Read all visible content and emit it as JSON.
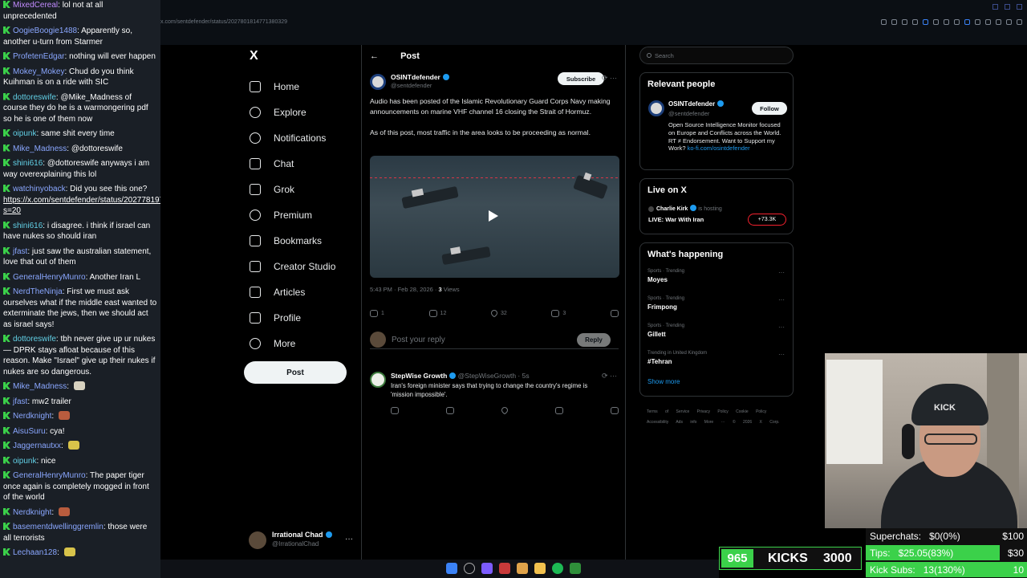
{
  "browser": {
    "url": "x.com/sentdefender/status/2027801814771380329"
  },
  "chat": {
    "messages": [
      {
        "user": "MixedCereal",
        "text": "lol not at all unprecedented",
        "color": "u-purple"
      },
      {
        "user": "OogieBoogie1488",
        "text": "Apparently so, another u-turn from Starmer",
        "color": "uname"
      },
      {
        "user": "ProfetenEdgar",
        "text": "nothing will ever happen",
        "color": "uname"
      },
      {
        "user": "Mokey_Mokey",
        "text": "Chud do you think Kuihman is on a ride with SIC",
        "color": "uname"
      },
      {
        "user": "dottoreswife",
        "text": "@Mike_Madness of course they do he is a warmongering pdf so he is one of them now",
        "color": "u-cyan"
      },
      {
        "user": "oipunk",
        "text": "same shit every time",
        "color": "u-cyan"
      },
      {
        "user": "Mike_Madness",
        "text": "@dottoreswife",
        "color": "uname"
      },
      {
        "user": "shini616",
        "text": "@dottoreswife anyways i am way overexplaining this lol",
        "color": "u-cyan"
      },
      {
        "user": "watchinyoback",
        "text": "Did you see this one?",
        "link": "https://x.com/sentdefender/status/2027781971875610711?s=20",
        "color": "uname"
      },
      {
        "user": "shini616",
        "text": "i disagree. i think if israel can have nukes so should iran",
        "color": "u-cyan"
      },
      {
        "user": "jfast",
        "text": "just saw the australian statement, love that out of them",
        "color": "uname"
      },
      {
        "user": "GeneralHenryMunro",
        "text": "Another Iran L",
        "color": "uname"
      },
      {
        "user": "NerdTheNinja",
        "text": "First we must ask ourselves what if the middle east wanted to exterminate the jews, then we should act as israel says!",
        "color": "uname"
      },
      {
        "user": "dottoreswife",
        "text": "tbh never give up ur nukes — DPRK stays afloat because of this reason. Make \"Israel\" give up their nukes if nukes are so dangerous.",
        "color": "u-cyan"
      },
      {
        "user": "Mike_Madness",
        "text": "",
        "color": "uname"
      },
      {
        "user": "jfast",
        "text": "mw2 trailer",
        "color": "uname"
      },
      {
        "user": "Nerdknight",
        "text": "",
        "color": "uname"
      },
      {
        "user": "AisuSuru",
        "text": "cya!",
        "color": "uname"
      },
      {
        "user": "Jaggernautxx",
        "text": "",
        "color": "uname"
      },
      {
        "user": "oipunk",
        "text": "nice",
        "color": "u-cyan"
      },
      {
        "user": "GeneralHenryMunro",
        "text": "The paper tiger once again is completely mogged in front of the world",
        "color": "uname"
      },
      {
        "user": "Nerdknight",
        "text": "",
        "color": "uname"
      },
      {
        "user": "basementdwellinggremlin",
        "text": "those were all terrorists",
        "color": "uname"
      },
      {
        "user": "Lechaan128",
        "text": "",
        "color": "uname"
      }
    ]
  },
  "sidebar": {
    "logo": "X",
    "items": [
      {
        "label": "Home",
        "icon": "home-icon"
      },
      {
        "label": "Explore",
        "icon": "search-icon"
      },
      {
        "label": "Notifications",
        "icon": "bell-icon"
      },
      {
        "label": "Chat",
        "icon": "mail-icon"
      },
      {
        "label": "Grok",
        "icon": "grok-icon"
      },
      {
        "label": "Premium",
        "icon": "premium-icon"
      },
      {
        "label": "Bookmarks",
        "icon": "bookmark-icon"
      },
      {
        "label": "Creator Studio",
        "icon": "creator-icon"
      },
      {
        "label": "Articles",
        "icon": "articles-icon"
      },
      {
        "label": "Profile",
        "icon": "profile-icon"
      },
      {
        "label": "More",
        "icon": "more-icon"
      }
    ],
    "post_label": "Post",
    "account": {
      "name": "Irrational Chad",
      "handle": "@IrrationalChad",
      "more": "···"
    }
  },
  "main": {
    "back": "←",
    "title": "Post",
    "post": {
      "name": "OSINTdefender",
      "handle": "@sentdefender",
      "subscribe": "Subscribe",
      "paragraph1": "Audio has been posted of the Islamic Revolutionary Guard Corps Navy making announcements on marine VHF channel 16 closing the Strait of Hormuz.",
      "paragraph2": "As of this post, most traffic in the area looks to be proceeding as normal.",
      "time": "5:43 PM · Feb 28, 2026 · ",
      "views_count": "3",
      "views_label": " Views",
      "replies": "1",
      "reposts": "12",
      "likes": "32",
      "bookmarks": "3"
    },
    "reply_placeholder": "Post your reply",
    "reply_button": "Reply",
    "reply": {
      "name": "StepWise Growth",
      "handle": "@StepWiseGrowth · 5s",
      "text": "Iran's foreign minister says that trying to change the country's regime is 'mission impossible'."
    }
  },
  "right": {
    "search_placeholder": "Search",
    "relevant_title": "Relevant people",
    "person": {
      "name": "OSINTdefender",
      "handle": "@sentdefender",
      "follow": "Follow",
      "bio": "Open Source Intelligence Monitor focused on Europe and Conflicts across the World. RT ≠ Endorsement. Want to Support my Work? ",
      "bio_link": "ko-fi.com/osintdefender"
    },
    "live_title": "Live on X",
    "live": {
      "host": "Charlie Kirk",
      "status": "is hosting",
      "title": "LIVE: War With Iran",
      "count": "+73.3K"
    },
    "happening_title": "What's happening",
    "trends": [
      {
        "category": "Sports · Trending",
        "topic": "Moyes"
      },
      {
        "category": "Sports · Trending",
        "topic": "Frimpong"
      },
      {
        "category": "Sports · Trending",
        "topic": "Gillett"
      },
      {
        "category": "Trending in United Kingdom",
        "topic": "#Tehran"
      }
    ],
    "show_more": "Show more",
    "footer": "Terms of Service  Privacy Policy  Cookie Policy  Accessibility  Ads info  More ···  © 2026 X Corp."
  },
  "overlay": {
    "kicks_count": "965",
    "kicks_label": "KICKS",
    "kicks_goal": "3000",
    "goals": [
      {
        "label": "Superchats:",
        "value": "$0(0%)",
        "target": "$100",
        "fraction": 0.0
      },
      {
        "label": "Tips:",
        "value": "$25.05(83%)",
        "target": "$30",
        "fraction": 0.83
      },
      {
        "label": "Kick Subs:",
        "value": "13(130%)",
        "target": "10",
        "fraction": 1.0
      }
    ],
    "cam_text": "KICK"
  },
  "colors": {
    "accent": "#1d9bf0",
    "kick_green": "#3bd14a",
    "live_red": "#f4212e"
  }
}
